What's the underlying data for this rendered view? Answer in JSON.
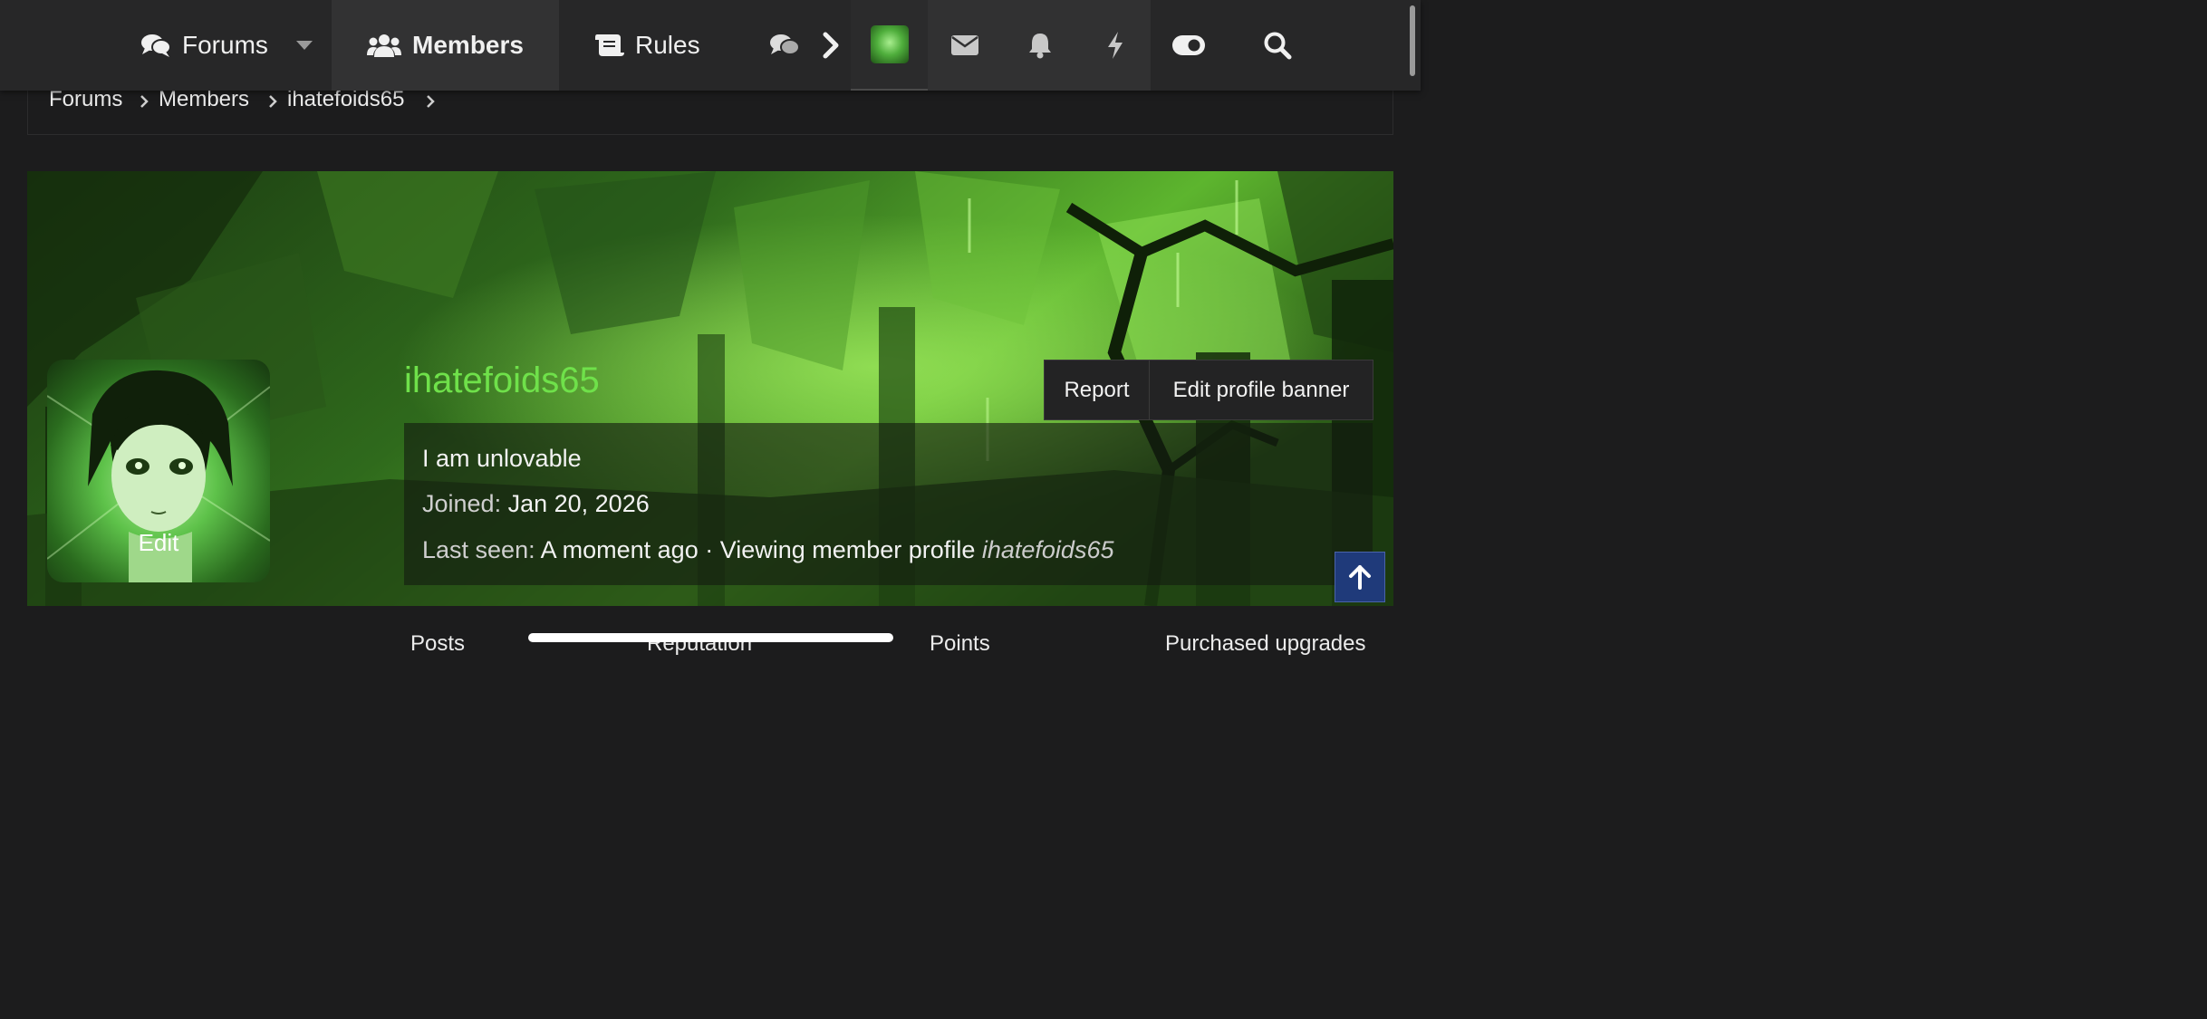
{
  "nav": {
    "forums_label": "Forums",
    "members_label": "Members",
    "rules_label": "Rules"
  },
  "breadcrumb": {
    "items": [
      "Forums",
      "Members",
      "ihatefoids65"
    ]
  },
  "profile": {
    "username": "ihatefoids65",
    "avatar_edit_label": "Edit",
    "report_label": "Report",
    "edit_banner_label": "Edit profile banner",
    "custom_title": "I am unlovable",
    "joined_label": "Joined:",
    "joined_value": "Jan 20, 2026",
    "last_seen_label": "Last seen:",
    "last_seen_value": "A moment ago · Viewing member profile",
    "last_seen_target": "ihatefoids65"
  },
  "stats": {
    "posts_label": "Posts",
    "reputation_label": "Reputation",
    "points_label": "Points",
    "upgrades_label": "Purchased upgrades"
  },
  "colors": {
    "accent_green": "#6fe14a",
    "background": "#1c1c1d",
    "nav_background": "#272728",
    "to_top_button": "#1f3a7a"
  }
}
